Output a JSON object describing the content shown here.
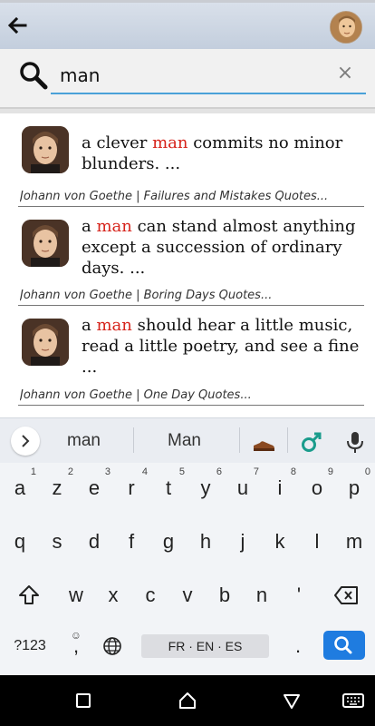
{
  "topbar": {
    "back_icon": "arrow-left-icon"
  },
  "search": {
    "value": "man",
    "clear_glyph": "×"
  },
  "results": [
    {
      "pre": "a clever ",
      "hl": "man",
      "post": " commits no minor blunders. ...",
      "source": "Johann von Goethe | Failures and Mistakes Quotes..."
    },
    {
      "pre": "a ",
      "hl": "man",
      "post": " can stand almost anything except a succession of ordinary days. ...",
      "source": "Johann von Goethe | Boring Days Quotes..."
    },
    {
      "pre": "a ",
      "hl": "man",
      "post": " should hear a little music, read a little poetry, and see a fine ...",
      "source": "Johann von Goethe | One Day Quotes..."
    }
  ],
  "keyboard": {
    "suggestions": [
      "man",
      "Man"
    ],
    "row1": [
      {
        "key": "a",
        "hint": "1"
      },
      {
        "key": "z",
        "hint": "2"
      },
      {
        "key": "e",
        "hint": "3"
      },
      {
        "key": "r",
        "hint": "4"
      },
      {
        "key": "t",
        "hint": "5"
      },
      {
        "key": "y",
        "hint": "6"
      },
      {
        "key": "u",
        "hint": "7"
      },
      {
        "key": "i",
        "hint": "8"
      },
      {
        "key": "o",
        "hint": "9"
      },
      {
        "key": "p",
        "hint": "0"
      }
    ],
    "row2": [
      "q",
      "s",
      "d",
      "f",
      "g",
      "h",
      "j",
      "k",
      "l",
      "m"
    ],
    "row3": [
      "w",
      "x",
      "c",
      "v",
      "b",
      "n",
      "'"
    ],
    "symbols_label": "?123",
    "comma_label": ",",
    "period_label": ".",
    "space_label": "FR · EN · ES"
  }
}
